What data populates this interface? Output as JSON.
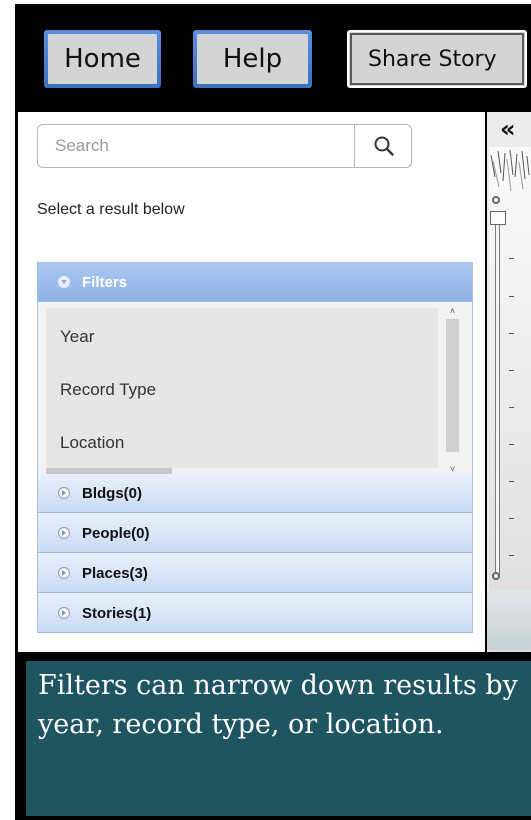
{
  "nav": {
    "home_label": "Home",
    "help_label": "Help",
    "share_label": "Share Story"
  },
  "search": {
    "placeholder": "Search",
    "value": "",
    "icon": "search-icon"
  },
  "hint_text": "Select a result below",
  "accordion": {
    "filters_label": "Filters",
    "filter_items": [
      "Year",
      "Record Type",
      "Location"
    ],
    "sections": [
      {
        "label": "Bldgs(0)"
      },
      {
        "label": "People(0)"
      },
      {
        "label": "Places(3)"
      },
      {
        "label": "Stories(1)"
      }
    ]
  },
  "map_panel": {
    "collapse_icon": "double-chevron-left-icon",
    "zoom_level": 0
  },
  "caption_text": "Filters can narrow down results by year, record type, or location.",
  "colors": {
    "accent_blue": "#4a7fd4",
    "caption_bg": "#1f5461",
    "active_header": "#9fbdea"
  }
}
